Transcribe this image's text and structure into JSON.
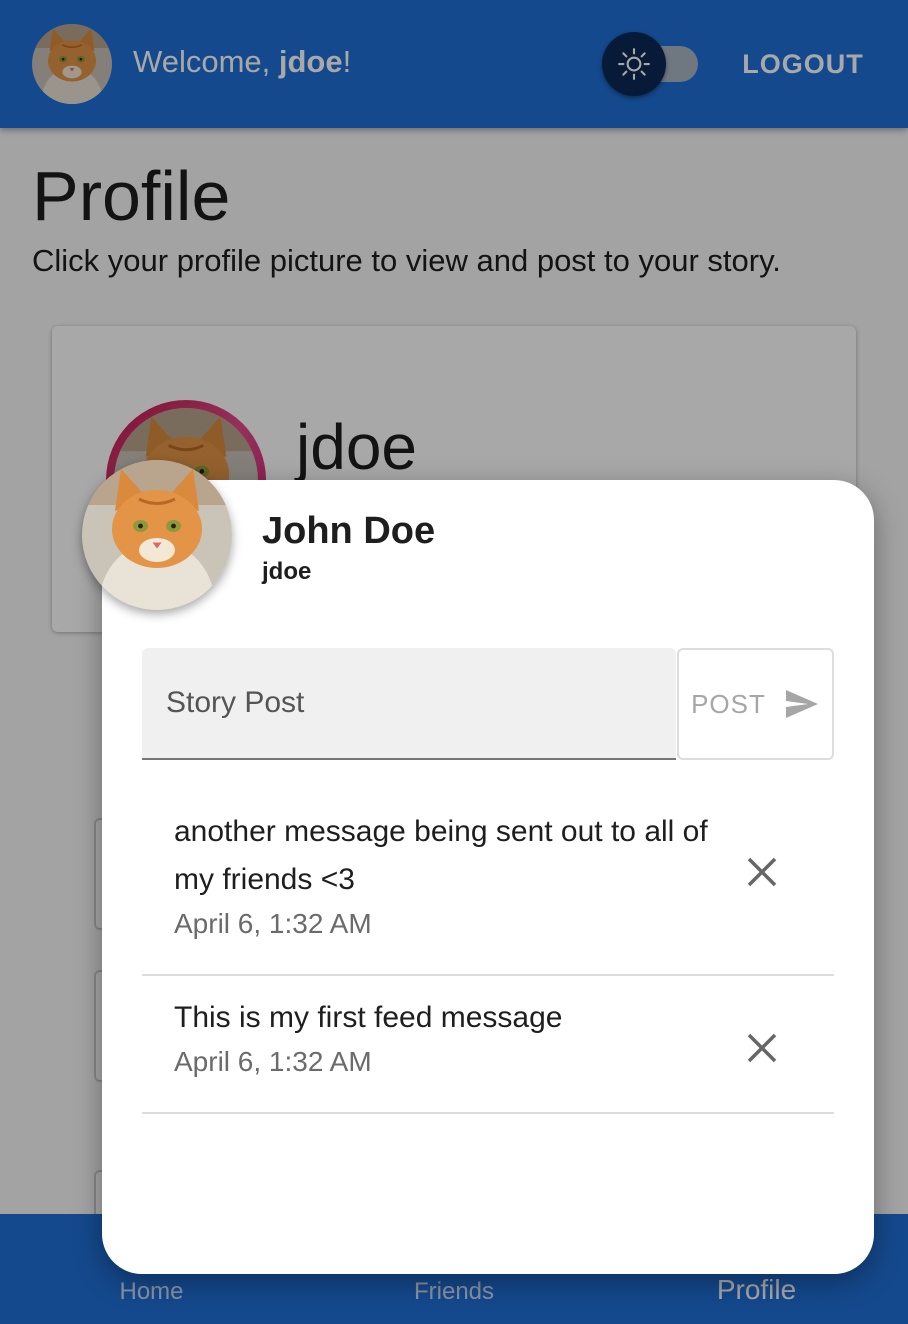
{
  "appbar": {
    "welcome_prefix": "Welcome, ",
    "username": "jdoe",
    "welcome_suffix": "!",
    "theme_toggle_icon": "sun-icon",
    "logout_label": "LOGOUT"
  },
  "page": {
    "title": "Profile",
    "subtitle": "Click your profile picture to view and post to your story."
  },
  "profile_card": {
    "username": "jdoe"
  },
  "dialog": {
    "name": "John Doe",
    "handle": "jdoe",
    "input_placeholder": "Story Post",
    "post_label": "POST",
    "feed": [
      {
        "message": "another message being sent out to all of my friends <3",
        "time": "April 6, 1:32 AM"
      },
      {
        "message": "This is my first feed message",
        "time": "April 6, 1:32 AM"
      }
    ]
  },
  "bottomnav": {
    "items": [
      {
        "label": "Home"
      },
      {
        "label": "Friends"
      },
      {
        "label": "Profile"
      }
    ],
    "active": "Profile"
  },
  "colors": {
    "primary": "#1f6fd6",
    "story_ring": "#c0184a"
  }
}
